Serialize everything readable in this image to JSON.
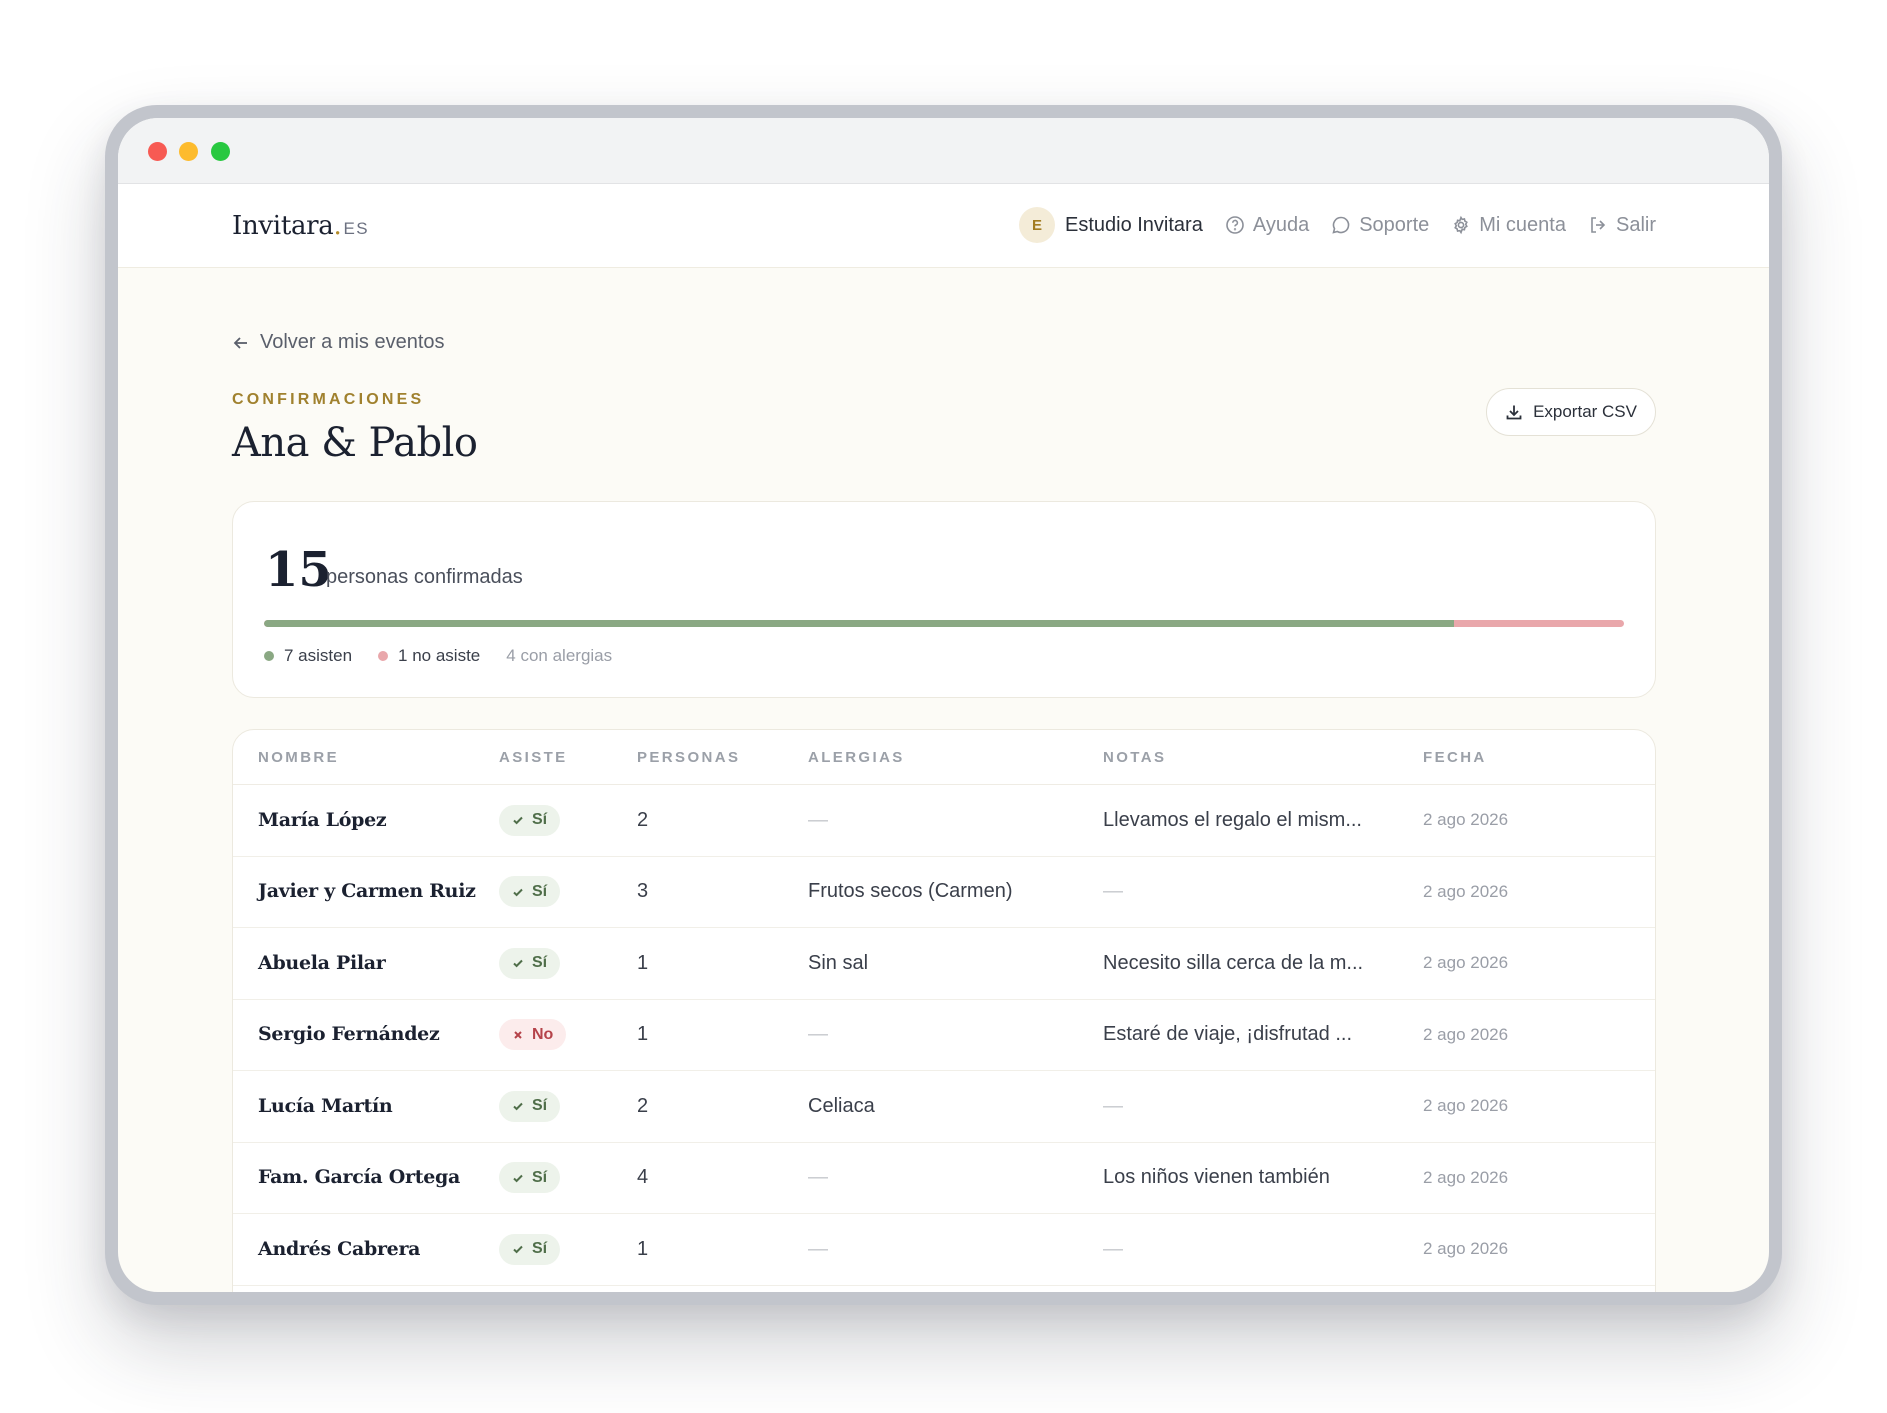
{
  "brand": {
    "name": "Invitara",
    "dot": ".",
    "tld": "ES"
  },
  "nav": {
    "avatar_initial": "E",
    "user_name": "Estudio Invitara",
    "help": "Ayuda",
    "support": "Soporte",
    "account": "Mi cuenta",
    "logout": "Salir"
  },
  "page": {
    "back_label": "Volver a mis eventos",
    "eyebrow": "CONFIRMACIONES",
    "title": "Ana & Pablo",
    "export_label": "Exportar CSV"
  },
  "summary": {
    "confirmed_count": "15",
    "confirmed_label": "personas confirmadas",
    "attending_fraction": 0.875,
    "attending": "7 asisten",
    "not_attending": "1 no asiste",
    "allergies": "4 con alergias",
    "colors": {
      "attending": "#8aa883",
      "not_attending": "#e9a7ab"
    }
  },
  "table": {
    "headers": [
      "NOMBRE",
      "ASISTE",
      "PERSONAS",
      "ALERGIAS",
      "NOTAS",
      "FECHA"
    ],
    "rows": [
      {
        "name": "María López",
        "attends": "Sí",
        "status": "yes",
        "people": "2",
        "allergies": "—",
        "notes": "Llevamos el regalo el mism...",
        "date": "2 ago 2026"
      },
      {
        "name": "Javier y Carmen Ruiz",
        "attends": "Sí",
        "status": "yes",
        "people": "3",
        "allergies": "Frutos secos (Carmen)",
        "notes": "—",
        "date": "2 ago 2026"
      },
      {
        "name": "Abuela Pilar",
        "attends": "Sí",
        "status": "yes",
        "people": "1",
        "allergies": "Sin sal",
        "notes": "Necesito silla cerca de la m...",
        "date": "2 ago 2026"
      },
      {
        "name": "Sergio Fernández",
        "attends": "No",
        "status": "no",
        "people": "1",
        "allergies": "—",
        "notes": "Estaré de viaje, ¡disfrutad ...",
        "date": "2 ago 2026"
      },
      {
        "name": "Lucía Martín",
        "attends": "Sí",
        "status": "yes",
        "people": "2",
        "allergies": "Celiaca",
        "notes": "—",
        "date": "2 ago 2026"
      },
      {
        "name": "Fam. García Ortega",
        "attends": "Sí",
        "status": "yes",
        "people": "4",
        "allergies": "—",
        "notes": "Los niños vienen también",
        "date": "2 ago 2026"
      },
      {
        "name": "Andrés Cabrera",
        "attends": "Sí",
        "status": "yes",
        "people": "1",
        "allergies": "—",
        "notes": "—",
        "date": "2 ago 2026"
      }
    ]
  }
}
